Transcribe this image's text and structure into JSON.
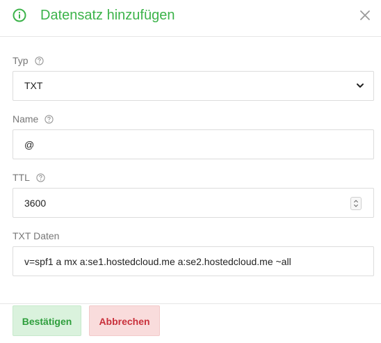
{
  "dialog": {
    "title": "Datensatz hinzufügen",
    "icon": "info-circle-icon",
    "accent_color": "#3cb34a"
  },
  "fields": {
    "type": {
      "label": "Typ",
      "value": "TXT"
    },
    "name": {
      "label": "Name",
      "value": "@"
    },
    "ttl": {
      "label": "TTL",
      "value": "3600"
    },
    "txt_data": {
      "label": "TXT Daten",
      "value": "v=spf1 a mx a:se1.hostedcloud.me a:se2.hostedcloud.me ~all"
    }
  },
  "buttons": {
    "confirm": {
      "label": "Bestätigen",
      "color": "#2e9e3c",
      "background": "#daf2dd"
    },
    "cancel": {
      "label": "Abbrechen",
      "color": "#c9303b",
      "background": "#f9dcdc"
    }
  }
}
